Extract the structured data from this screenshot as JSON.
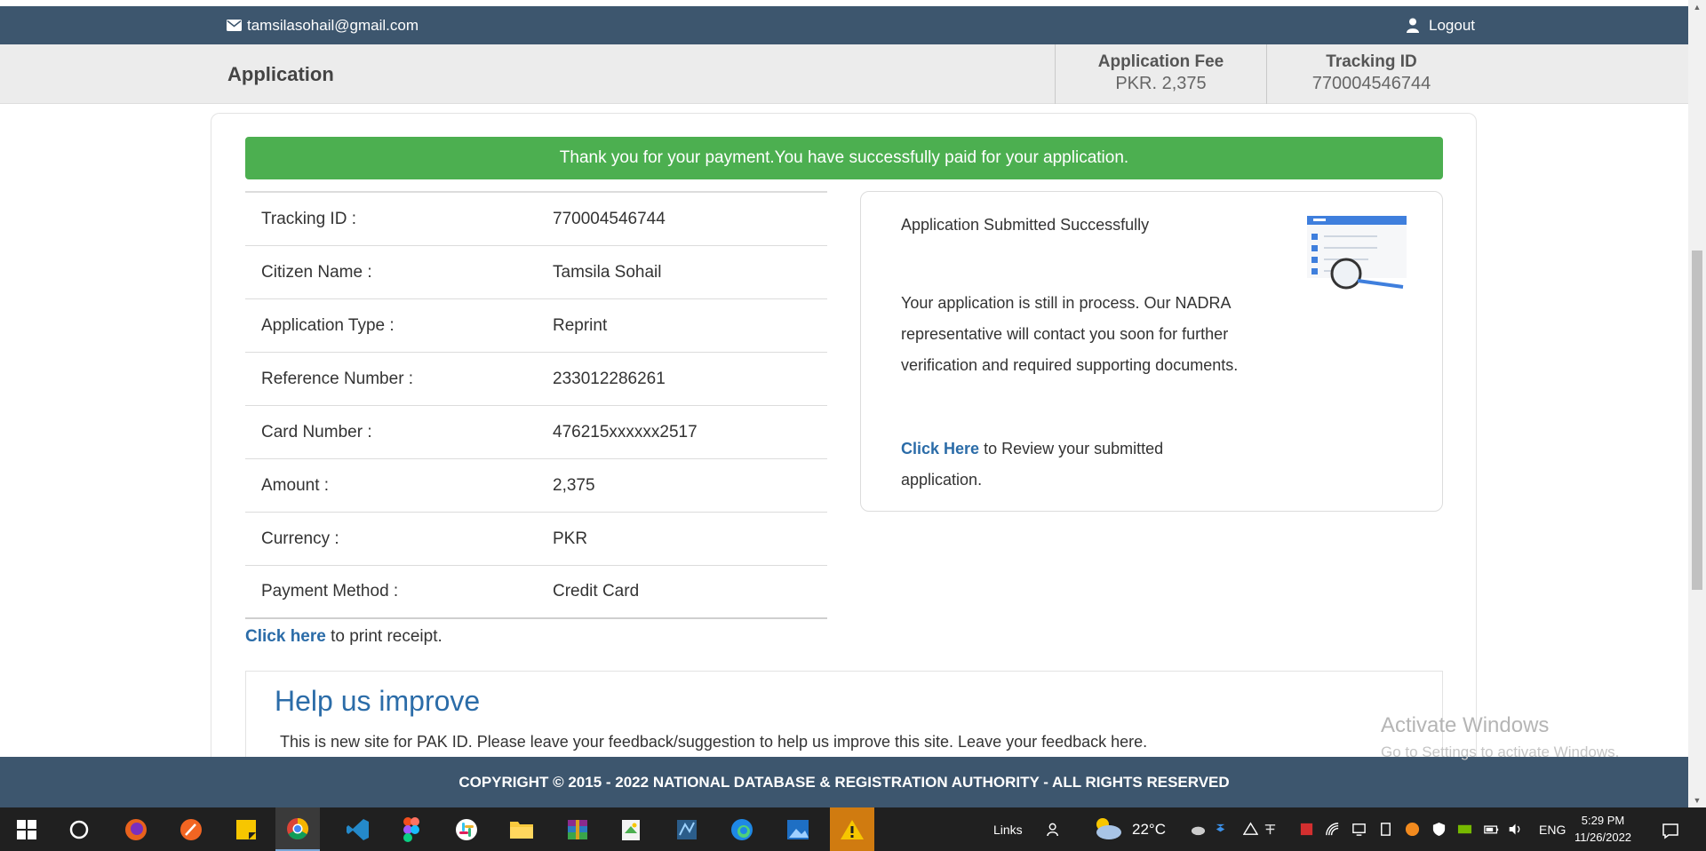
{
  "header": {
    "email": "tamsilasohail@gmail.com",
    "logout_label": "Logout"
  },
  "subheader": {
    "title": "Application",
    "fee_label": "Application Fee",
    "fee_value": "PKR. 2,375",
    "tracking_label": "Tracking ID",
    "tracking_value": "770004546744"
  },
  "banner": "Thank you for your payment.You have successfully paid for your application.",
  "details": [
    {
      "key": "Tracking ID :",
      "value": "770004546744"
    },
    {
      "key": "Citizen Name :",
      "value": "Tamsila Sohail"
    },
    {
      "key": "Application Type :",
      "value": "Reprint"
    },
    {
      "key": "Reference Number :",
      "value": "233012286261"
    },
    {
      "key": "Card Number :",
      "value": "476215xxxxxx2517"
    },
    {
      "key": "Amount :",
      "value": "2,375"
    },
    {
      "key": "Currency :",
      "value": "PKR"
    },
    {
      "key": "Payment Method :",
      "value": "Credit Card"
    }
  ],
  "print": {
    "link": "Click here",
    "text": " to print receipt."
  },
  "status": {
    "title": "Application Submitted Successfully",
    "message": "Your application is still in process. Our NADRA representative will contact you soon for further verification and required supporting documents.",
    "review_link": "Click Here",
    "review_text": " to Review your submitted application."
  },
  "feedback": {
    "title": "Help us improve",
    "text": "This is new site for PAK ID. Please leave your feedback/suggestion to help us improve this site. Leave your feedback here."
  },
  "watermark": {
    "line1": "Activate Windows",
    "line2": "Go to Settings to activate Windows."
  },
  "footer": "COPYRIGHT © 2015 - 2022 NATIONAL DATABASE & REGISTRATION AUTHORITY - ALL RIGHTS RESERVED",
  "taskbar": {
    "links_label": "Links",
    "temperature": "22°C",
    "language": "ENG",
    "time": "5:29 PM",
    "date": "11/26/2022"
  },
  "colors": {
    "header": "#3d566e",
    "success": "#4caf50",
    "link": "#2b6ca8"
  }
}
